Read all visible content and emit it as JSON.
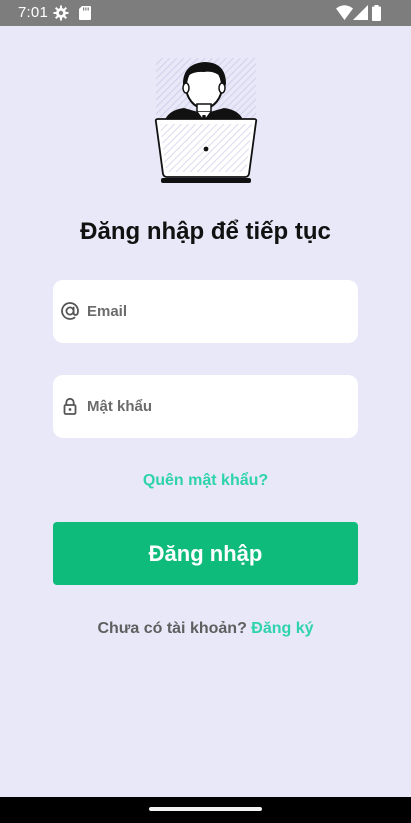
{
  "status_bar": {
    "time": "7:01",
    "icons": [
      "gear-icon",
      "sd-card-icon",
      "wifi-icon",
      "signal-icon",
      "battery-icon"
    ]
  },
  "illustration": {
    "icon": "user-at-laptop-illustration"
  },
  "login": {
    "title": "Đăng nhập để tiếp tục",
    "email": {
      "icon": "at-sign-icon",
      "placeholder": "Email",
      "value": ""
    },
    "password": {
      "icon": "lock-icon",
      "placeholder": "Mật khẩu",
      "value": ""
    },
    "forgot_password": "Quên mật khẩu?",
    "submit_label": "Đăng nhập",
    "signup_prompt": "Chưa có tài khoản?",
    "signup_link": "Đăng ký"
  },
  "colors": {
    "background": "#e8e8f9",
    "status_bar": "#7d7d7d",
    "primary_button": "#0fbb7b",
    "accent_link": "#2ed3ad",
    "input_background": "#ffffff"
  },
  "nav_bar": {
    "icon": "home-gesture-bar"
  }
}
